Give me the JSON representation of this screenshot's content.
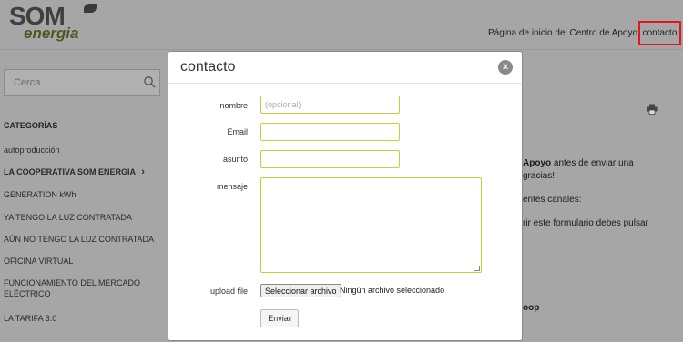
{
  "header": {
    "logo_top": "SOM",
    "logo_bottom": "energia",
    "nav_home": "Página de inicio del Centro de Apoyo",
    "nav_contact": "contacto"
  },
  "search": {
    "placeholder": "Cerca"
  },
  "sidebar": {
    "title": "CATEGORÍAS",
    "items": [
      {
        "label": "autoproducción"
      },
      {
        "label": "LA COOPERATIVA SOM ENERGIA"
      },
      {
        "label": "GENERATION kWh"
      },
      {
        "label": "YA TENGO LA LUZ CONTRATADA"
      },
      {
        "label": "AÚN NO TENGO LA LUZ CONTRATADA"
      },
      {
        "label": "OFICINA VIRTUAL"
      },
      {
        "label": "FUNCIONAMIENTO DEL MERCADO"
      },
      {
        "label": "ELÉCTRICO"
      },
      {
        "label": "LA TARIFA 3.0"
      }
    ],
    "chevron": "›"
  },
  "background_text": {
    "line1_bold": "Apoyo",
    "line1_rest": " antes de enviar una",
    "line2": "gracias!",
    "line3": "entes canales:",
    "line4": "rir este formulario debes pulsar",
    "line5": "oop"
  },
  "modal": {
    "title": "contacto",
    "close": "×",
    "labels": {
      "name": "nombre",
      "email": "Email",
      "subject": "asunto",
      "message": "mensaje",
      "upload": "upload file"
    },
    "name_placeholder": "(opcional)",
    "file_button": "Seleccionar archivo",
    "file_status": "Ningún archivo seleccionado",
    "submit": "Enviar"
  },
  "colors": {
    "accent_border": "#c9cf37",
    "highlight": "#e8141c"
  }
}
